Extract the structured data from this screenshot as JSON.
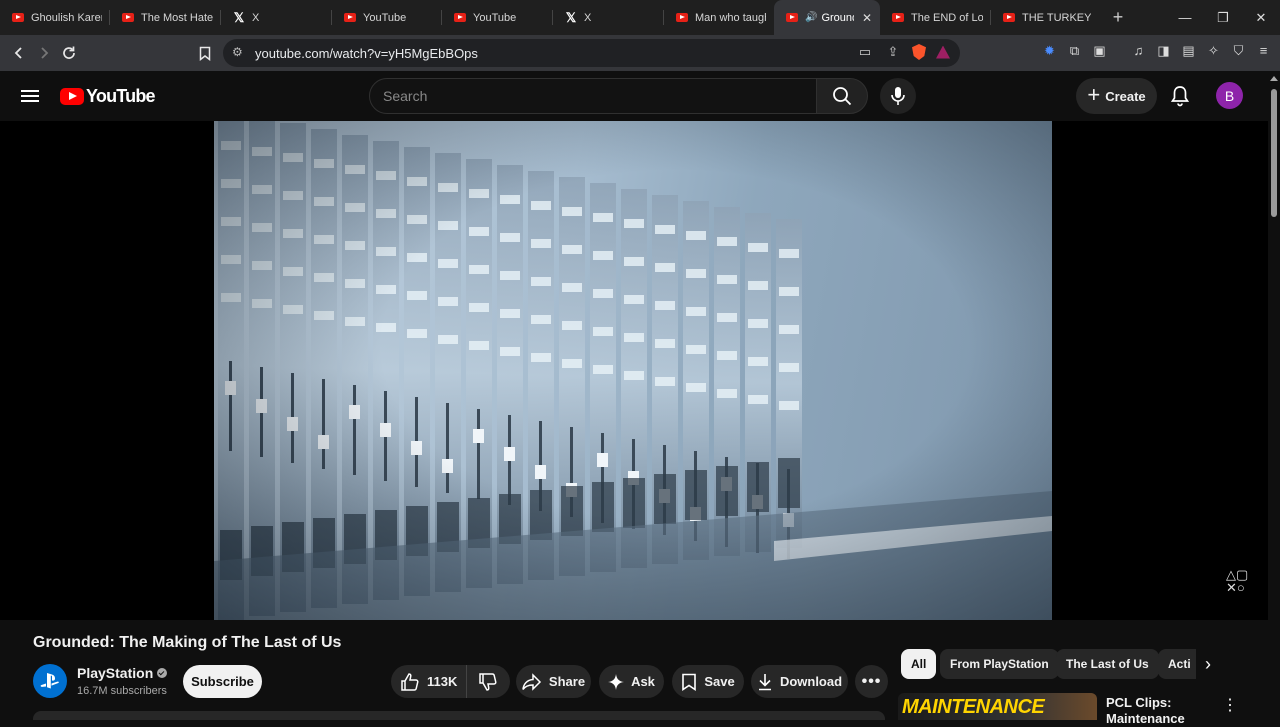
{
  "browser": {
    "tabs": [
      {
        "label": "Ghoulish Karen",
        "icon": "youtube-icon"
      },
      {
        "label": "The Most Hated",
        "icon": "youtube-icon"
      },
      {
        "label": "X",
        "icon": "x-icon"
      },
      {
        "label": "YouTube",
        "icon": "youtube-icon"
      },
      {
        "label": "YouTube",
        "icon": "youtube-icon"
      },
      {
        "label": "X",
        "icon": "x-icon"
      },
      {
        "label": "Man who taught",
        "icon": "youtube-icon"
      },
      {
        "label": "Grounde",
        "icon": "youtube-icon",
        "active": true
      },
      {
        "label": "The END of Lok",
        "icon": "youtube-icon"
      },
      {
        "label": "THE TURKEY TO",
        "icon": "youtube-icon"
      }
    ],
    "new_tab": "+",
    "url": "youtube.com/watch?v=yH5MgEbBOps"
  },
  "header": {
    "logo_text": "YouTube",
    "search_placeholder": "Search",
    "create_label": "Create",
    "avatar_letter": "B"
  },
  "video": {
    "title": "Grounded: The Making of The Last of Us",
    "channel": "PlayStation",
    "subscribers": "16.7M subscribers",
    "subscribe_label": "Subscribe",
    "likes": "113K",
    "actions": {
      "share": "Share",
      "ask": "Ask",
      "save": "Save",
      "download": "Download"
    }
  },
  "sidebar": {
    "chips": [
      "All",
      "From PlayStation",
      "The Last of Us",
      "Acti"
    ],
    "recommendation": {
      "thumb_text": "MAINTENANCE",
      "title": "PCL Clips: Maintenance"
    }
  },
  "colors": {
    "brand_red": "#ff0000",
    "avatar_purple": "#8e24aa",
    "background": "#0f0f0f"
  }
}
